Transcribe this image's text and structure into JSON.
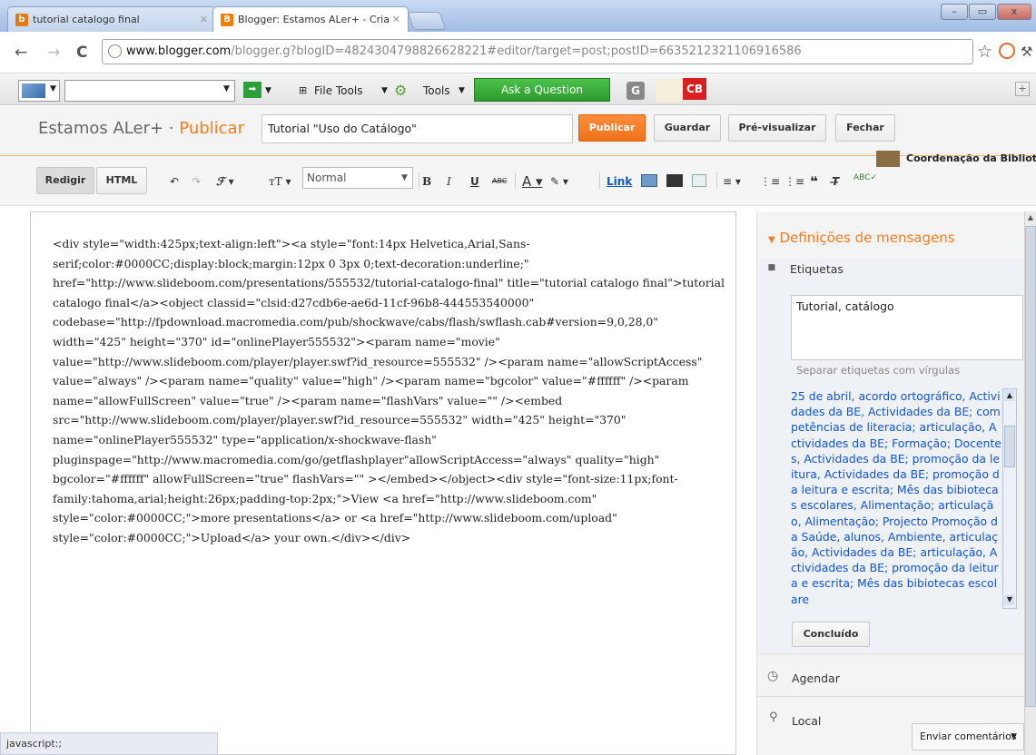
{
  "tabs": [
    {
      "title": "tutorial catalogo final",
      "favicon": "b"
    },
    {
      "title": "Blogger: Estamos ALer+ - Cria",
      "favicon": "B"
    }
  ],
  "window_buttons": [
    "–",
    "▭",
    "x"
  ],
  "nav": {
    "url_host": "www.blogger.com",
    "url_path": "/blogger.g?blogID=4824304798826628221#editor/target=post;postID=6635212321106916586"
  },
  "toolbar": {
    "file_tools": "File Tools",
    "tools": "Tools",
    "ask": "Ask a Question",
    "g_badge": "G",
    "cb_badge": "CB"
  },
  "header": {
    "blog_name": "Estamos ALer+",
    "dot": "·",
    "section": "Publicar",
    "post_title": "Tutorial \"Uso do Catálogo\"",
    "publish": "Publicar",
    "save": "Guardar",
    "preview": "Pré-visualizar",
    "close": "Fechar"
  },
  "editor_toolbar": {
    "compose": "Redigir",
    "html": "HTML",
    "font_size_value": "Normal",
    "bold": "B",
    "italic": "I",
    "underline": "U",
    "strike": "ABC",
    "link": "Link",
    "user_name": "Coordenação da Bibliote"
  },
  "code_text": "<div style=\"width:425px;text-align:left\"><a style=\"font:14px Helvetica,Arial,Sans-serif;color:#0000CC;display:block;margin:12px 0 3px 0;text-decoration:underline;\" href=\"http://www.slideboom.com/presentations/555532/tutorial-catalogo-final\" title=\"tutorial catalogo final\">tutorial catalogo final</a><object classid=\"clsid:d27cdb6e-ae6d-11cf-96b8-444553540000\" codebase=\"http://fpdownload.macromedia.com/pub/shockwave/cabs/flash/swflash.cab#version=9,0,28,0\" width=\"425\" height=\"370\" id=\"onlinePlayer555532\"><param name=\"movie\" value=\"http://www.slideboom.com/player/player.swf?id_resource=555532\" /><param name=\"allowScriptAccess\" value=\"always\" /><param name=\"quality\" value=\"high\" /><param name=\"bgcolor\" value=\"#ffffff\" /><param name=\"allowFullScreen\" value=\"true\" /><param name=\"flashVars\" value=\"\" /><embed src=\"http://www.slideboom.com/player/player.swf?id_resource=555532\" width=\"425\" height=\"370\" name=\"onlinePlayer555532\" type=\"application/x-shockwave-flash\" pluginspage=\"http://www.macromedia.com/go/getflashplayer\"allowScriptAccess=\"always\" quality=\"high\" bgcolor=\"#ffffff\" allowFullScreen=\"true\" flashVars=\"\" ></embed></object><div style=\"font-size:11px;font-family:tahoma,arial;height:26px;padding-top:2px;\">View <a href=\"http://www.slideboom.com\" style=\"color:#0000CC;\">more presentations</a> or <a href=\"http://www.slideboom.com/upload\" style=\"color:#0000CC;\">Upload</a> your own.</div></div>",
  "sidebar": {
    "section_title": "Definições de mensagens",
    "labels_title": "Etiquetas",
    "labels_value": "Tutorial, catálogo",
    "labels_hint": "Separar etiquetas com vírgulas",
    "tag_suggestions": "25 de abril, acordo ortográfico, Actividades da BE, Actividades da BE; competências de literacia; articulação, Actividades da BE; Formação; Docentes, Actividades da BE; promoção da leitura, Actividades da BE; promoção da leitura e escrita; Mês das bibiotecas escolares, Alimentação; articulação, Alimentação; Projecto Promoção da Saúde, alunos, Ambiente, articulação, Actividades da BE; articulação, Actividades da BE; promoção da leitura e escrita; Mês das bibiotecas escolare",
    "done": "Concluído",
    "schedule": "Agendar",
    "location": "Local"
  },
  "status_text": "javascript:;",
  "feedback": "Enviar comentários",
  "colors": {
    "accent": "#f57d1f",
    "link": "#1255cc",
    "ask_green": "#35a835"
  }
}
